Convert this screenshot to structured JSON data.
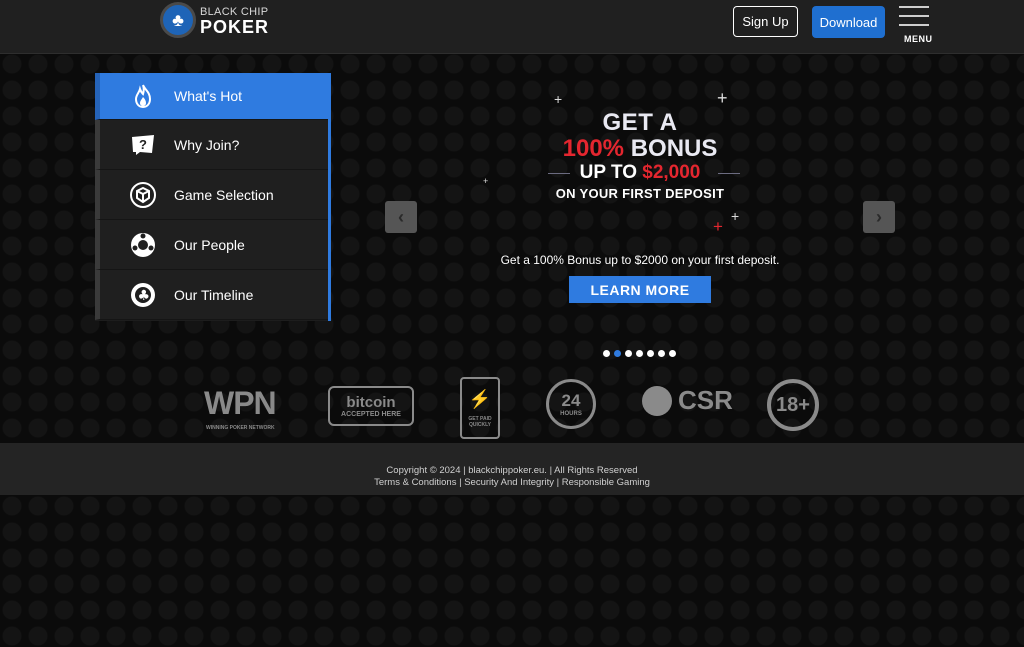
{
  "header": {
    "logo_line1": "BLACK CHIP",
    "logo_line2": "POKER",
    "signup_label": "Sign Up",
    "download_label": "Download",
    "menu_label": "MENU"
  },
  "sidenav": {
    "items": [
      {
        "label": "What's Hot",
        "icon": "flame-icon"
      },
      {
        "label": "Why Join?",
        "icon": "question-card-icon"
      },
      {
        "label": "Game Selection",
        "icon": "cube-icon"
      },
      {
        "label": "Our People",
        "icon": "people-chip-icon"
      },
      {
        "label": "Our Timeline",
        "icon": "club-chip-icon"
      }
    ]
  },
  "promo": {
    "line1": "GET A",
    "line2_red": "100%",
    "line2_white": "BONUS",
    "line3_white": "UP TO",
    "line3_red": "$2,000",
    "line4": "ON YOUR FIRST DEPOSIT",
    "description": "Get a 100% Bonus up to $2000 on your first deposit.",
    "cta_label": "LEARN MORE"
  },
  "carousel": {
    "slide_count": 7,
    "active_index": 1
  },
  "partners": {
    "wpn": "WPN",
    "wpn_sub": "WINNING POKER NETWORK",
    "bitcoin": "bitcoin",
    "bitcoin_sub": "ACCEPTED HERE",
    "fast_sub": "GET PAID QUICKLY",
    "hours": "24",
    "hours_sub": "HOURS",
    "csr": "CSR",
    "age": "18+"
  },
  "footer": {
    "copyright": "Copyright © 2024  |  blackchippoker.eu. | All Rights Reserved",
    "links": "Terms & Conditions | Security And Integrity | Responsible Gaming"
  },
  "colors": {
    "accent": "#2f7be0",
    "promo_red": "#e4262f",
    "header_bg": "#202020",
    "footer_bg": "#242424"
  }
}
